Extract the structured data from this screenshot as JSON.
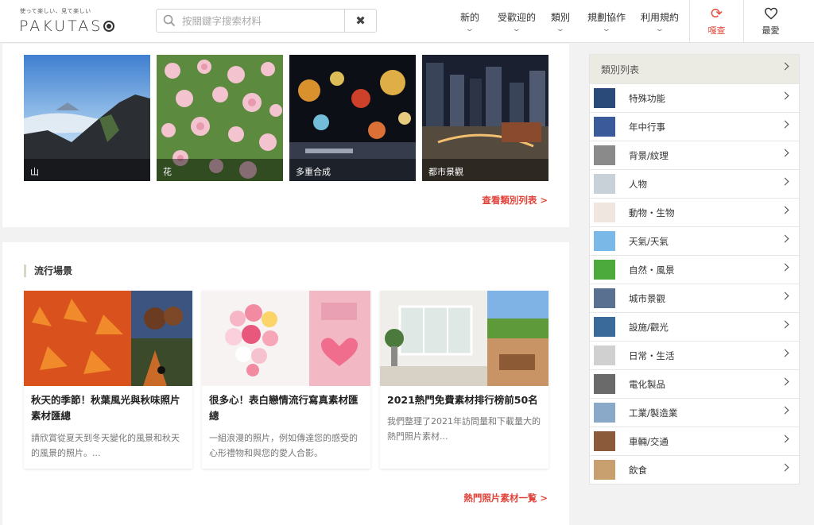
{
  "header": {
    "logo_tagline": "使って楽しい、見て楽しい",
    "logo_text": "PAKUTAS",
    "search": {
      "placeholder": "按關鍵字搜索材料"
    },
    "nav": [
      {
        "label": "新的"
      },
      {
        "label": "受歡迎的"
      },
      {
        "label": "類別"
      },
      {
        "label": "規劃協作"
      },
      {
        "label": "利用規約"
      }
    ],
    "tools": [
      {
        "label": "嘎查",
        "icon": "refresh-icon",
        "color": "#e8483b"
      },
      {
        "label": "最愛",
        "icon": "heart-icon",
        "color": "#333333"
      }
    ]
  },
  "categories_panel": {
    "thumbs": [
      {
        "caption": "山"
      },
      {
        "caption": "花"
      },
      {
        "caption": "多重合成"
      },
      {
        "caption": "都市景觀"
      }
    ],
    "more_link": "查看類別列表 >"
  },
  "trending": {
    "title": "流行場景",
    "cards": [
      {
        "title": "秋天的季節！秋葉風光與秋味照片素材匯總",
        "desc": "請欣賞從夏天到冬天變化的風景和秋天的風景的照片。..."
      },
      {
        "title": "很多心！表白戀情流行寫真素材匯總",
        "desc": "一組浪漫的照片，例如傳達您的感受的心形禮物和與您的愛人合影。"
      },
      {
        "title": "2021熱門免費素材排行榜前50名",
        "desc": "我們整理了2021年訪問量和下載量大的熱門照片素材..."
      }
    ],
    "more_link": "熱門照片素材一覧 >"
  },
  "sidebar": {
    "title": "類別列表",
    "items": [
      {
        "label": "特殊功能"
      },
      {
        "label": "年中行事"
      },
      {
        "label": "背景/紋理"
      },
      {
        "label": "人物"
      },
      {
        "label": "動物・生物"
      },
      {
        "label": "天氣/天氣"
      },
      {
        "label": "自然・風景"
      },
      {
        "label": "城市景觀"
      },
      {
        "label": "設施/觀光"
      },
      {
        "label": "日常・生活"
      },
      {
        "label": "電化製品"
      },
      {
        "label": "工業/製造業"
      },
      {
        "label": "車輛/交通"
      },
      {
        "label": "飲食"
      }
    ]
  },
  "colors": {
    "accent": "#e0443a",
    "sidebar_header_bg": "#ecebe3"
  }
}
